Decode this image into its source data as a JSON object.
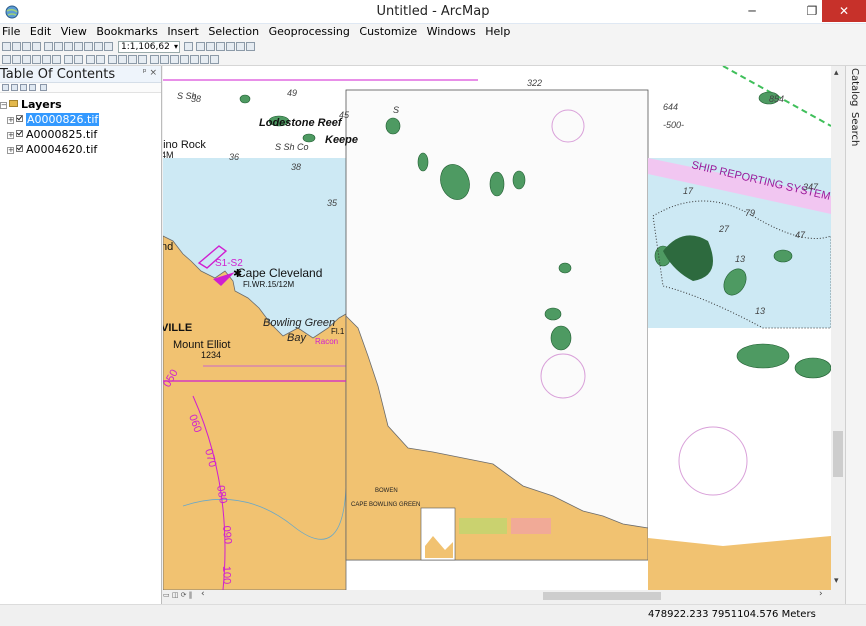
{
  "window": {
    "title": "Untitled - ArcMap",
    "minimize_glyph": "─",
    "maximize_glyph": "❐",
    "close_glyph": "✕"
  },
  "menu": [
    "File",
    "Edit",
    "View",
    "Bookmarks",
    "Insert",
    "Selection",
    "Geoprocessing",
    "Customize",
    "Windows",
    "Help"
  ],
  "toolbar": {
    "scale_value": "1:1,106,62"
  },
  "toc": {
    "title": "Table Of Contents",
    "pin_glyph": "ᵖ ×",
    "root": "Layers",
    "layers": [
      {
        "name": "A0000826.tif",
        "selected": true
      },
      {
        "name": "A0000825.tif",
        "selected": false
      },
      {
        "name": "A0004620.tif",
        "selected": false
      }
    ]
  },
  "map": {
    "labels": {
      "lodestone_reef": "Lodestone Reef",
      "keeper": "Keepe",
      "pino_rock": "pino Rock",
      "four_m": "4M",
      "cape_cleveland": "Cape Cleveland",
      "light_char": "Fl.WR.15/12M",
      "s1s2": "S1-S2",
      "nd": "nd",
      "ville": "VILLE",
      "mount_elliot": "Mount Elliot",
      "mount_elliot_height": "1234",
      "bowling_green_bay": "Bowling Green",
      "bay": "Bay",
      "fl1": "Fl.1",
      "racon": "Racon",
      "ship_reporting": "SHIP REPORTING SYSTEM (S",
      "bowen": "BOWEN",
      "cape_bowling_green": "CAPE BOWLING GREEN",
      "s_sh": "S Sh",
      "s_sh_co": "S Sh Co",
      "s": "S"
    },
    "depths": [
      "38",
      "49",
      "45",
      "36",
      "38",
      "35",
      "322",
      "644",
      "-500-",
      "854",
      "347",
      "17",
      "79",
      "27",
      "47",
      "13",
      "13"
    ],
    "compass_ticks": [
      "050",
      "060",
      "070",
      "080",
      "090",
      "100"
    ]
  },
  "dock": {
    "catalog": "Catalog",
    "search": "Search"
  },
  "status": {
    "coordinates": "478922.233  7951104.576 Meters"
  },
  "colors": {
    "sea": "#cde9f4",
    "land": "#f1c271",
    "reef": "#4e9a62",
    "magenta": "#d01fd0",
    "selection": "#3399ff",
    "close_button": "#c7312a"
  }
}
